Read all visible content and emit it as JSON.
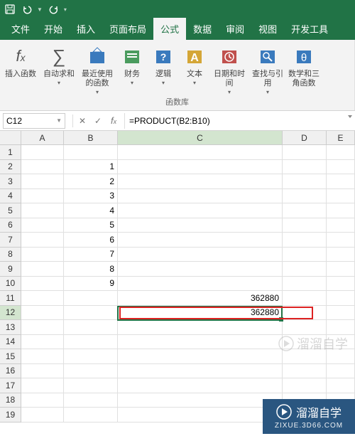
{
  "qat": {
    "save": "save",
    "undo": "undo",
    "redo": "redo"
  },
  "tabs": {
    "file": "文件",
    "home": "开始",
    "insert": "插入",
    "layout": "页面布局",
    "formulas": "公式",
    "data": "数据",
    "review": "审阅",
    "view": "视图",
    "developer": "开发工具"
  },
  "ribbon": {
    "insert_fn": "插入函数",
    "autosum": "自动求和",
    "recent": "最近使用的函数",
    "financial": "财务",
    "logical": "逻辑",
    "text": "文本",
    "datetime": "日期和时间",
    "lookup": "查找与引用",
    "math": "数学和三角函数",
    "group_name": "函数库"
  },
  "namebox": {
    "value": "C12"
  },
  "formula_bar": {
    "value": "=PRODUCT(B2:B10)"
  },
  "columns": [
    "A",
    "B",
    "C",
    "D",
    "E"
  ],
  "row_numbers": [
    "1",
    "2",
    "3",
    "4",
    "5",
    "6",
    "7",
    "8",
    "9",
    "10",
    "11",
    "12",
    "13",
    "14",
    "15",
    "16",
    "17",
    "18",
    "19"
  ],
  "cells": {
    "B2": "1",
    "B3": "2",
    "B4": "3",
    "B5": "4",
    "B6": "5",
    "B7": "6",
    "B8": "7",
    "B9": "8",
    "B10": "9",
    "C11": "362880",
    "C12": "362880"
  },
  "colors": {
    "brand_green": "#217346",
    "red_box": "#d22",
    "brand_blue": "#2a5680"
  },
  "watermark": {
    "text": "溜溜自学"
  },
  "brand": {
    "name": "溜溜自学",
    "url": "ZIXUE.3D66.COM"
  },
  "chart_data": {
    "type": "table",
    "note": "not a chart"
  }
}
